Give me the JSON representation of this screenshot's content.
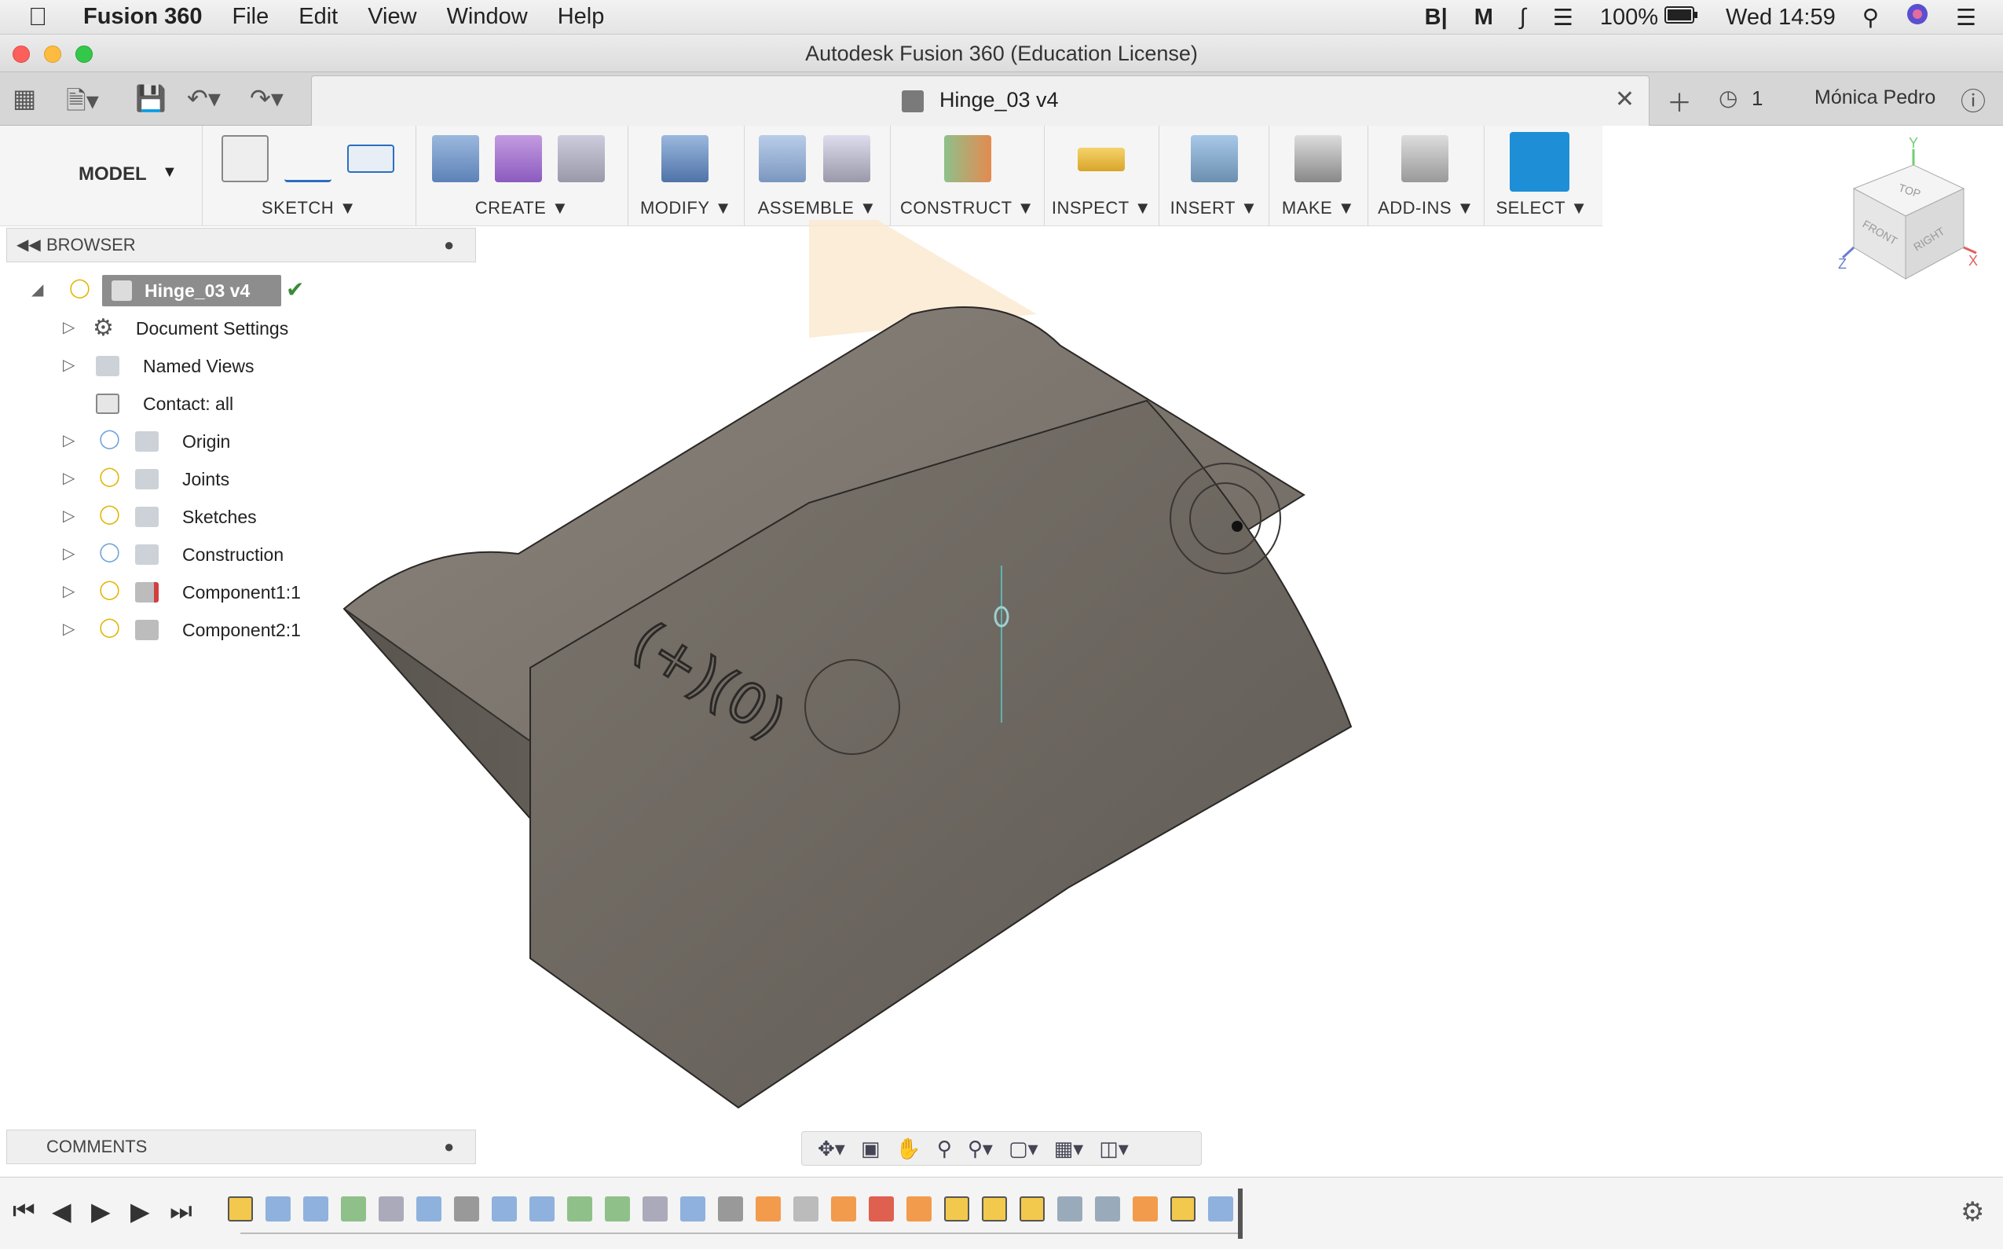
{
  "menubar": {
    "app_name": "Fusion 360",
    "items": [
      "File",
      "Edit",
      "View",
      "Window",
      "Help"
    ],
    "battery": "100%",
    "clock": "Wed 14:59"
  },
  "window": {
    "title": "Autodesk Fusion 360 (Education License)"
  },
  "tabbar": {
    "doc_tab": "Hinge_03 v4",
    "job_count": "1",
    "user": "Mónica Pedro"
  },
  "toolbar": {
    "workspace": "MODEL",
    "groups": [
      "SKETCH",
      "CREATE",
      "MODIFY",
      "ASSEMBLE",
      "CONSTRUCT",
      "INSPECT",
      "INSERT",
      "MAKE",
      "ADD-INS",
      "SELECT"
    ]
  },
  "browser": {
    "title": "BROWSER",
    "root": "Hinge_03 v4",
    "items": [
      {
        "label": "Document Settings",
        "icon": "gear-icon"
      },
      {
        "label": "Named Views",
        "icon": "folder-icon"
      },
      {
        "label": "Contact: all",
        "icon": "contact-icon"
      },
      {
        "label": "Origin",
        "icon": "folder-icon"
      },
      {
        "label": "Joints",
        "icon": "folder-icon"
      },
      {
        "label": "Sketches",
        "icon": "folder-icon"
      },
      {
        "label": "Construction",
        "icon": "folder-icon"
      },
      {
        "label": "Component1:1",
        "icon": "component-icon"
      },
      {
        "label": "Component2:1",
        "icon": "component-icon"
      }
    ]
  },
  "comments": {
    "title": "COMMENTS"
  },
  "viewcube": {
    "top": "TOP",
    "front": "FRONT",
    "right": "RIGHT",
    "axis_x": "X",
    "axis_y": "Y",
    "axis_z": "Z"
  },
  "colors": {
    "select_blue": "#1e8fd6",
    "model_gray": "#6d6760"
  }
}
